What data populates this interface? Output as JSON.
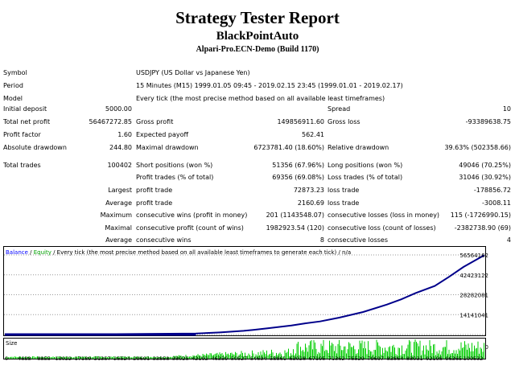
{
  "report": {
    "title": "Strategy Tester Report",
    "expert": "BlackPointAuto",
    "server": "Alpari-Pro.ECN-Demo (Build 1170)"
  },
  "info": {
    "symbol_label": "Symbol",
    "symbol_value": "USDJPY (US Dollar vs Japanese Yen)",
    "period_label": "Period",
    "period_value": "15 Minutes (M15) 1999.01.05 09:45 - 2019.02.15 23:45 (1999.01.01 - 2019.02.17)",
    "model_label": "Model",
    "model_value": "Every tick (the most precise method based on all available least timeframes)"
  },
  "stats": {
    "initial_deposit_label": "Initial deposit",
    "initial_deposit": "5000.00",
    "spread_label": "Spread",
    "spread": "10",
    "total_net_profit_label": "Total net profit",
    "total_net_profit": "56467272.85",
    "gross_profit_label": "Gross profit",
    "gross_profit": "149856911.60",
    "gross_loss_label": "Gross loss",
    "gross_loss": "-93389638.75",
    "profit_factor_label": "Profit factor",
    "profit_factor": "1.60",
    "expected_payoff_label": "Expected payoff",
    "expected_payoff": "562.41",
    "absolute_drawdown_label": "Absolute drawdown",
    "absolute_drawdown": "244.80",
    "maximal_drawdown_label": "Maximal drawdown",
    "maximal_drawdown": "6723781.40 (18.60%)",
    "relative_drawdown_label": "Relative drawdown",
    "relative_drawdown": "39.63% (502358.66)",
    "total_trades_label": "Total trades",
    "total_trades": "100402",
    "short_positions_label": "Short positions (won %)",
    "short_positions": "51356 (67.96%)",
    "long_positions_label": "Long positions (won %)",
    "long_positions": "49046 (70.25%)",
    "profit_trades_label": "Profit trades (% of total)",
    "profit_trades": "69356 (69.08%)",
    "loss_trades_label": "Loss trades (% of total)",
    "loss_trades": "31046 (30.92%)",
    "largest_label": "Largest",
    "largest_profit_label": "profit trade",
    "largest_profit": "72873.23",
    "largest_loss_label": "loss trade",
    "largest_loss": "-178856.72",
    "average_label": "Average",
    "average_profit_label": "profit trade",
    "average_profit": "2160.69",
    "average_loss_label": "loss trade",
    "average_loss": "-3008.11",
    "maximum_label": "Maximum",
    "max_consec_wins_label": "consecutive wins (profit in money)",
    "max_consec_wins": "201 (1143548.07)",
    "max_consec_losses_label": "consecutive losses (loss in money)",
    "max_consec_losses": "115 (-1726990.15)",
    "maximal_label": "Maximal",
    "maximal_consec_profit_label": "consecutive profit (count of wins)",
    "maximal_consec_profit": "1982923.54 (120)",
    "maximal_consec_loss_label": "consecutive loss (count of losses)",
    "maximal_consec_loss": "-2382738.90 (69)",
    "average2_label": "Average",
    "avg_consec_wins_label": "consecutive wins",
    "avg_consec_wins": "8",
    "avg_consec_losses_label": "consecutive losses",
    "avg_consec_losses": "4"
  },
  "chart_legend": {
    "balance": "Balance",
    "sep": " / ",
    "equity": "Equity",
    "rest": " / Every tick (the most precise method based on all available least timeframes to generate each tick) / n/a"
  },
  "colors": {
    "balance": "#0000ff",
    "equity": "#00a000",
    "balance_line": "#00008b",
    "size_bars": "#00cc00"
  },
  "chart_data": {
    "type": "line",
    "title": "",
    "x_ticks": [
      "0",
      "4688",
      "8855",
      "13022",
      "17189",
      "21357",
      "25524",
      "29691",
      "33858",
      "38025",
      "42192",
      "46359",
      "50527",
      "54694",
      "58861",
      "63028",
      "67195",
      "71362",
      "75529",
      "79697",
      "83864",
      "88031",
      "92198",
      "96365",
      "100532"
    ],
    "y_ticks": [
      "56564162",
      "42423122",
      "28282081",
      "14141041",
      "0"
    ],
    "ylim": [
      0,
      56564162
    ],
    "xlim": [
      0,
      100402
    ],
    "series": [
      {
        "name": "Balance",
        "x": [
          0,
          20000,
          40000,
          45000,
          50000,
          52000,
          55000,
          60000,
          63000,
          66000,
          70000,
          75000,
          80000,
          83000,
          86000,
          90000,
          93000,
          96000,
          100402
        ],
        "values": [
          5000,
          150000,
          700000,
          1500000,
          2600000,
          3300000,
          4400000,
          6400000,
          8000000,
          9300000,
          12000000,
          16000000,
          21300000,
          25000000,
          29500000,
          34500000,
          41000000,
          48000000,
          56467273
        ]
      }
    ],
    "size_label": "Size"
  }
}
